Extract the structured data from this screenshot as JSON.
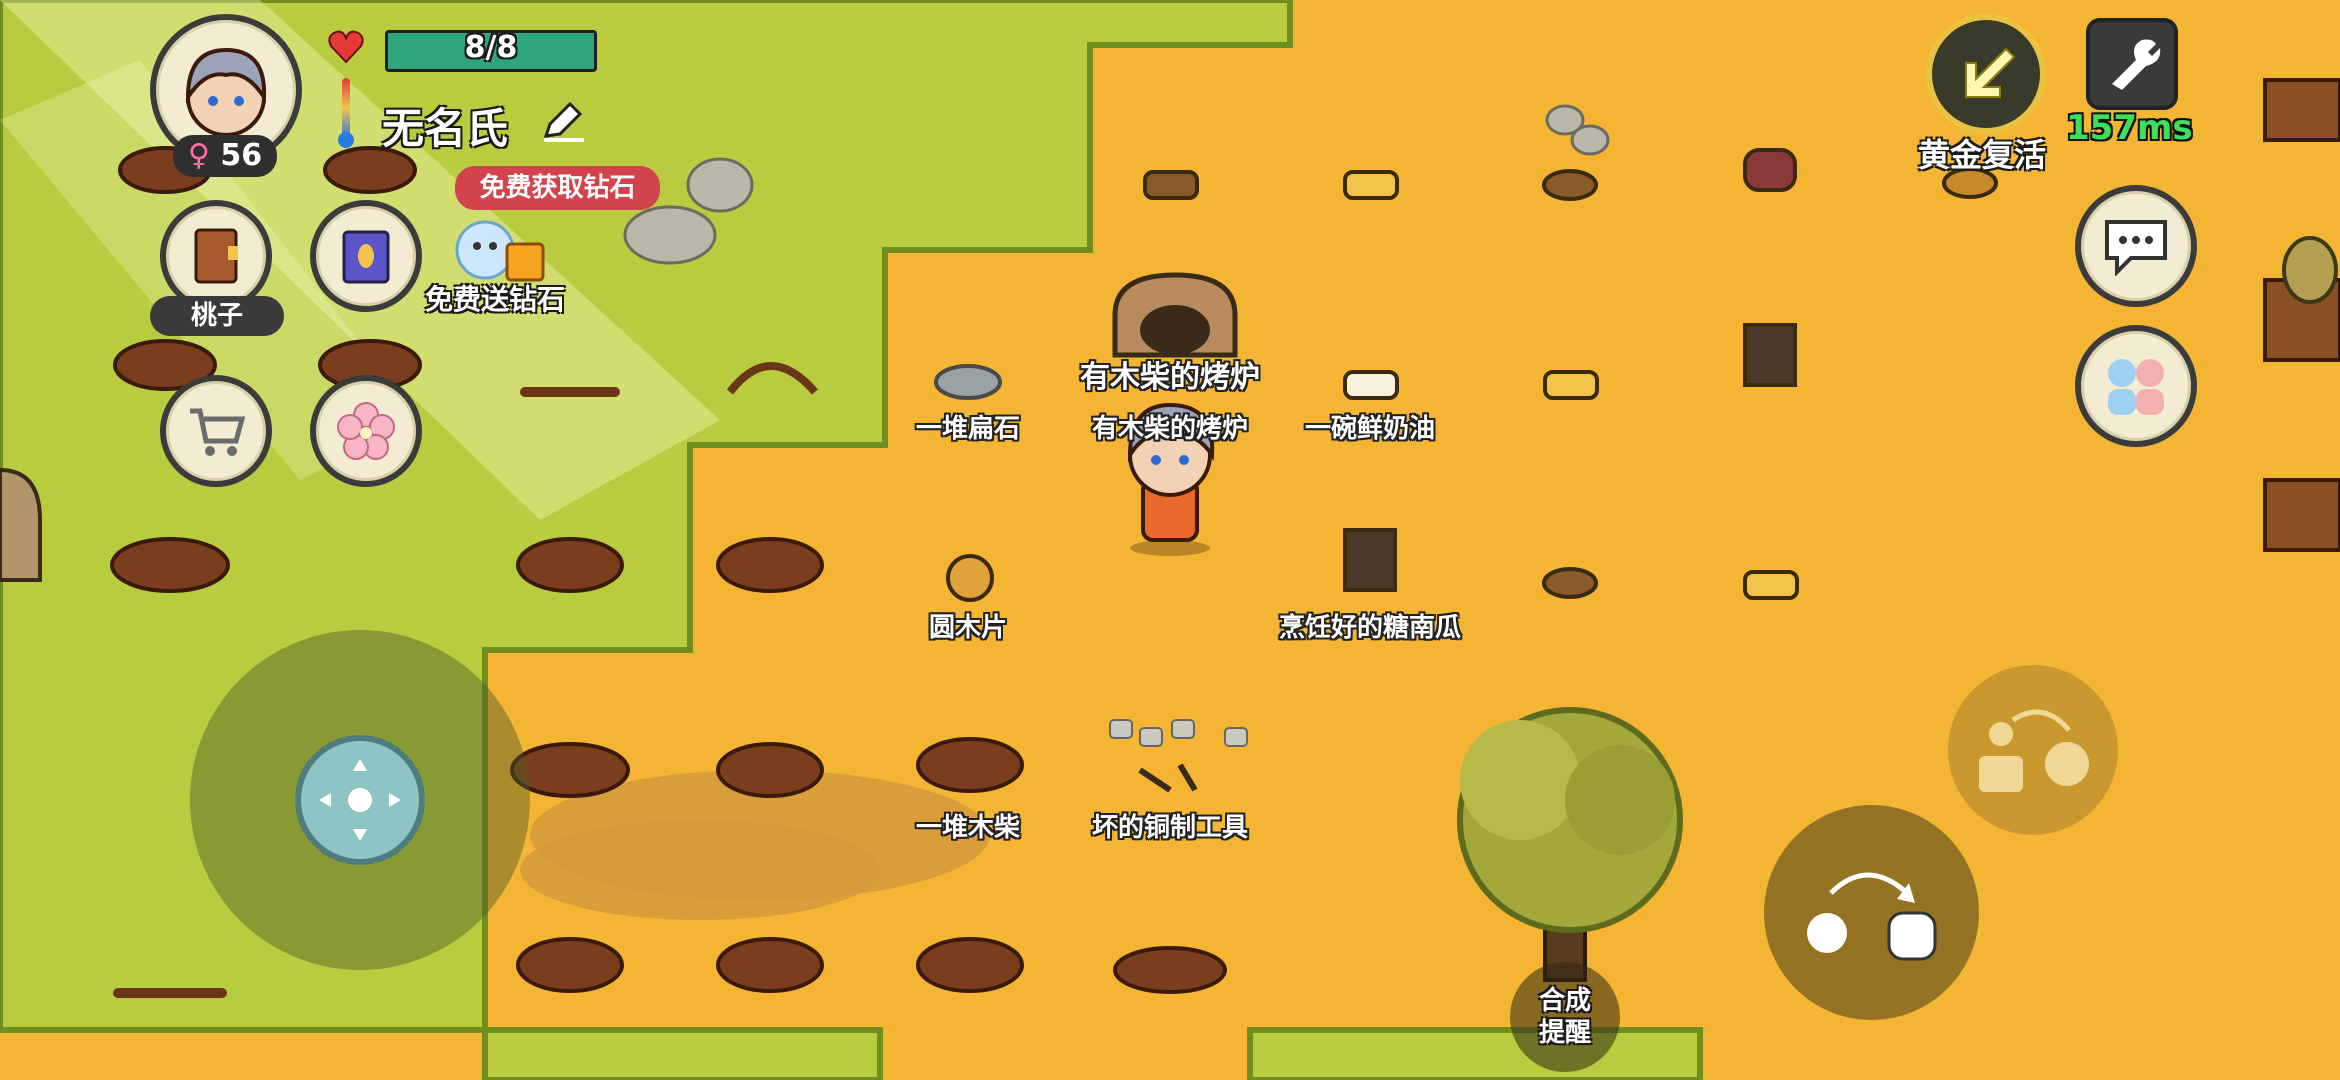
{
  "hud": {
    "health_text": "8/8",
    "health_fraction": 1.0,
    "player_name": "无名氏",
    "age": "56",
    "gender_symbol": "♀",
    "free_diamond_badge": "免费获取钻石",
    "free_diamond_label": "免费送钻石",
    "book_label": "桃子",
    "golden_revive_label": "黄金复活",
    "ping": "157ms",
    "craft_hint_label": "合成提醒"
  },
  "world": {
    "oven_title": "有木柴的烤炉",
    "labels": {
      "flat_stones": "一堆扁石",
      "oven": "有木柴的烤炉",
      "butter_bowl": "一碗鲜奶油",
      "log_slice": "圆木片",
      "cooked_pumpkin": "烹饪好的糖南瓜",
      "firewood_pile": "一堆木柴",
      "broken_tools": "坏的铜制工具"
    }
  },
  "colors": {
    "grass": "#b9cc3f",
    "sand": "#f4b534",
    "health_bar": "#2fa57c",
    "ping_green": "#3ee05a",
    "badge_red": "#d2434b"
  },
  "icons": [
    "heart-icon",
    "thermometer-icon",
    "edit-pencil-icon",
    "book-icon",
    "spellbook-icon",
    "diamond-gift-icon",
    "cart-icon",
    "blossom-icon",
    "revive-arrow-icon",
    "wrench-icon",
    "chat-icon",
    "friends-icon",
    "grab-icon",
    "throw-icon",
    "joystick-icon"
  ]
}
